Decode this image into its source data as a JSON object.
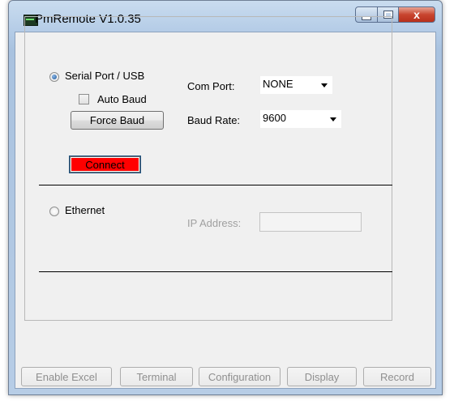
{
  "window": {
    "title": "PmRemote  V1.0.35",
    "close_glyph": "x"
  },
  "serial": {
    "radio_label": "Serial Port / USB",
    "auto_baud_label": "Auto Baud",
    "force_baud_label": "Force Baud",
    "com_port_label": "Com Port:",
    "com_port_value": "NONE",
    "baud_rate_label": "Baud Rate:",
    "baud_rate_value": "9600",
    "connect_label": "Connect",
    "connect_color": "#ff0000"
  },
  "ethernet": {
    "radio_label": "Ethernet",
    "ip_label": "IP Address:",
    "ip_value": ""
  },
  "bottom_buttons": [
    {
      "label": "Enable Excel"
    },
    {
      "label": "Terminal"
    },
    {
      "label": "Configuration"
    },
    {
      "label": "Display"
    },
    {
      "label": "Record"
    }
  ],
  "icons": {
    "app": "pmremote-app-icon",
    "minimize": "minimize-icon",
    "maximize": "maximize-icon",
    "close": "close-icon",
    "dropdown": "chevron-down-icon"
  }
}
